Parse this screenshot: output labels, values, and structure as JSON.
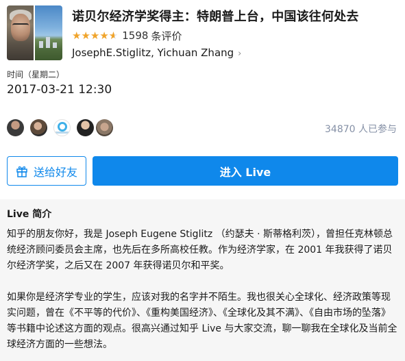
{
  "header": {
    "title": "诺贝尔经济学奖得主：特朗普上台，中国该往何处去",
    "rating": 4.5,
    "rating_count": "1598",
    "rating_suffix": "条评价",
    "speakers": "JosephE.Stiglitz, Yichuan Zhang",
    "cover_icon": "cover-image"
  },
  "time": {
    "label": "时间（星期二）",
    "value": "2017-03-21 12:30"
  },
  "participants": {
    "count_text": "34870 人已参与"
  },
  "actions": {
    "gift_label": "送给好友",
    "enter_label": "进入 Live"
  },
  "intro": {
    "title": "Live 简介",
    "paragraph1": "知乎的朋友你好，我是 Joseph Eugene Stiglitz （约瑟夫 · 斯蒂格利茨），曾担任克林顿总统经济顾问委员会主席，也先后在多所高校任教。作为经济学家，在 2001 年我获得了诺贝尔经济学奖，之后又在 2007 年获得诺贝尔和平奖。",
    "paragraph2": "如果你是经济学专业的学生，应该对我的名字并不陌生。我也很关心全球化、经济政策等现实问题，曾在《不平等的代价》、《重构美国经济》、《全球化及其不满》、《自由市场的坠落》等书籍中论述这方面的观点。很高兴通过知乎 Live 与大家交流，聊一聊我在全球化及当前全球经济方面的一些想法。"
  },
  "colors": {
    "accent": "#0f88eb",
    "star": "#f0a42b",
    "muted": "#8590a6",
    "intro_bg": "#f6f6f6"
  }
}
